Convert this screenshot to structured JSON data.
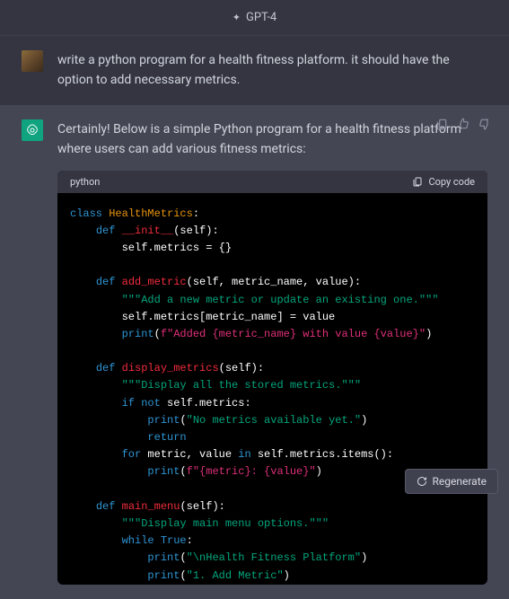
{
  "header": {
    "model": "GPT-4"
  },
  "user_message": "write a python program for a health fitness platform. it should have the option to add necessary metrics.",
  "assistant_intro": "Certainly! Below is a simple Python program for a health fitness platform where users can add various fitness metrics:",
  "code": {
    "language": "python",
    "copy_label": "Copy code",
    "tokens": [
      [
        {
          "c": "tok-kw",
          "t": "class"
        },
        {
          "t": " "
        },
        {
          "c": "tok-cls",
          "t": "HealthMetrics"
        },
        {
          "t": ":"
        }
      ],
      [
        {
          "t": "    "
        },
        {
          "c": "tok-kw",
          "t": "def"
        },
        {
          "t": " "
        },
        {
          "c": "tok-def",
          "t": "__init__"
        },
        {
          "t": "(self):"
        }
      ],
      [
        {
          "t": "        self.metrics = {}"
        }
      ],
      [],
      [
        {
          "t": "    "
        },
        {
          "c": "tok-kw",
          "t": "def"
        },
        {
          "t": " "
        },
        {
          "c": "tok-def",
          "t": "add_metric"
        },
        {
          "t": "(self, metric_name, value):"
        }
      ],
      [
        {
          "t": "        "
        },
        {
          "c": "tok-str",
          "t": "\"\"\"Add a new metric or update an existing one.\"\"\""
        }
      ],
      [
        {
          "t": "        self.metrics[metric_name] = value"
        }
      ],
      [
        {
          "t": "        "
        },
        {
          "c": "tok-fn",
          "t": "print"
        },
        {
          "t": "("
        },
        {
          "c": "tok-fstr",
          "t": "f\"Added {metric_name} with value {value}\""
        },
        {
          "t": ")"
        }
      ],
      [],
      [
        {
          "t": "    "
        },
        {
          "c": "tok-kw",
          "t": "def"
        },
        {
          "t": " "
        },
        {
          "c": "tok-def",
          "t": "display_metrics"
        },
        {
          "t": "(self):"
        }
      ],
      [
        {
          "t": "        "
        },
        {
          "c": "tok-str",
          "t": "\"\"\"Display all the stored metrics.\"\"\""
        }
      ],
      [
        {
          "t": "        "
        },
        {
          "c": "tok-kw",
          "t": "if"
        },
        {
          "t": " "
        },
        {
          "c": "tok-kw",
          "t": "not"
        },
        {
          "t": " self.metrics:"
        }
      ],
      [
        {
          "t": "            "
        },
        {
          "c": "tok-fn",
          "t": "print"
        },
        {
          "t": "("
        },
        {
          "c": "tok-str",
          "t": "\"No metrics available yet.\""
        },
        {
          "t": ")"
        }
      ],
      [
        {
          "t": "            "
        },
        {
          "c": "tok-kw",
          "t": "return"
        }
      ],
      [
        {
          "t": "        "
        },
        {
          "c": "tok-kw",
          "t": "for"
        },
        {
          "t": " metric, value "
        },
        {
          "c": "tok-kw",
          "t": "in"
        },
        {
          "t": " self.metrics.items():"
        }
      ],
      [
        {
          "t": "            "
        },
        {
          "c": "tok-fn",
          "t": "print"
        },
        {
          "t": "("
        },
        {
          "c": "tok-fstr",
          "t": "f\"{metric}: {value}\""
        },
        {
          "t": ")"
        }
      ],
      [],
      [
        {
          "t": "    "
        },
        {
          "c": "tok-kw",
          "t": "def"
        },
        {
          "t": " "
        },
        {
          "c": "tok-def",
          "t": "main_menu"
        },
        {
          "t": "(self):"
        }
      ],
      [
        {
          "t": "        "
        },
        {
          "c": "tok-str",
          "t": "\"\"\"Display main menu options.\"\"\""
        }
      ],
      [
        {
          "t": "        "
        },
        {
          "c": "tok-kw",
          "t": "while"
        },
        {
          "t": " "
        },
        {
          "c": "tok-bool",
          "t": "True"
        },
        {
          "t": ":"
        }
      ],
      [
        {
          "t": "            "
        },
        {
          "c": "tok-fn",
          "t": "print"
        },
        {
          "t": "("
        },
        {
          "c": "tok-str",
          "t": "\"\\nHealth Fitness Platform\""
        },
        {
          "t": ")"
        }
      ],
      [
        {
          "t": "            "
        },
        {
          "c": "tok-fn",
          "t": "print"
        },
        {
          "t": "("
        },
        {
          "c": "tok-str",
          "t": "\"1. Add Metric\""
        },
        {
          "t": ")"
        }
      ]
    ]
  },
  "regenerate_label": "Regenerate"
}
